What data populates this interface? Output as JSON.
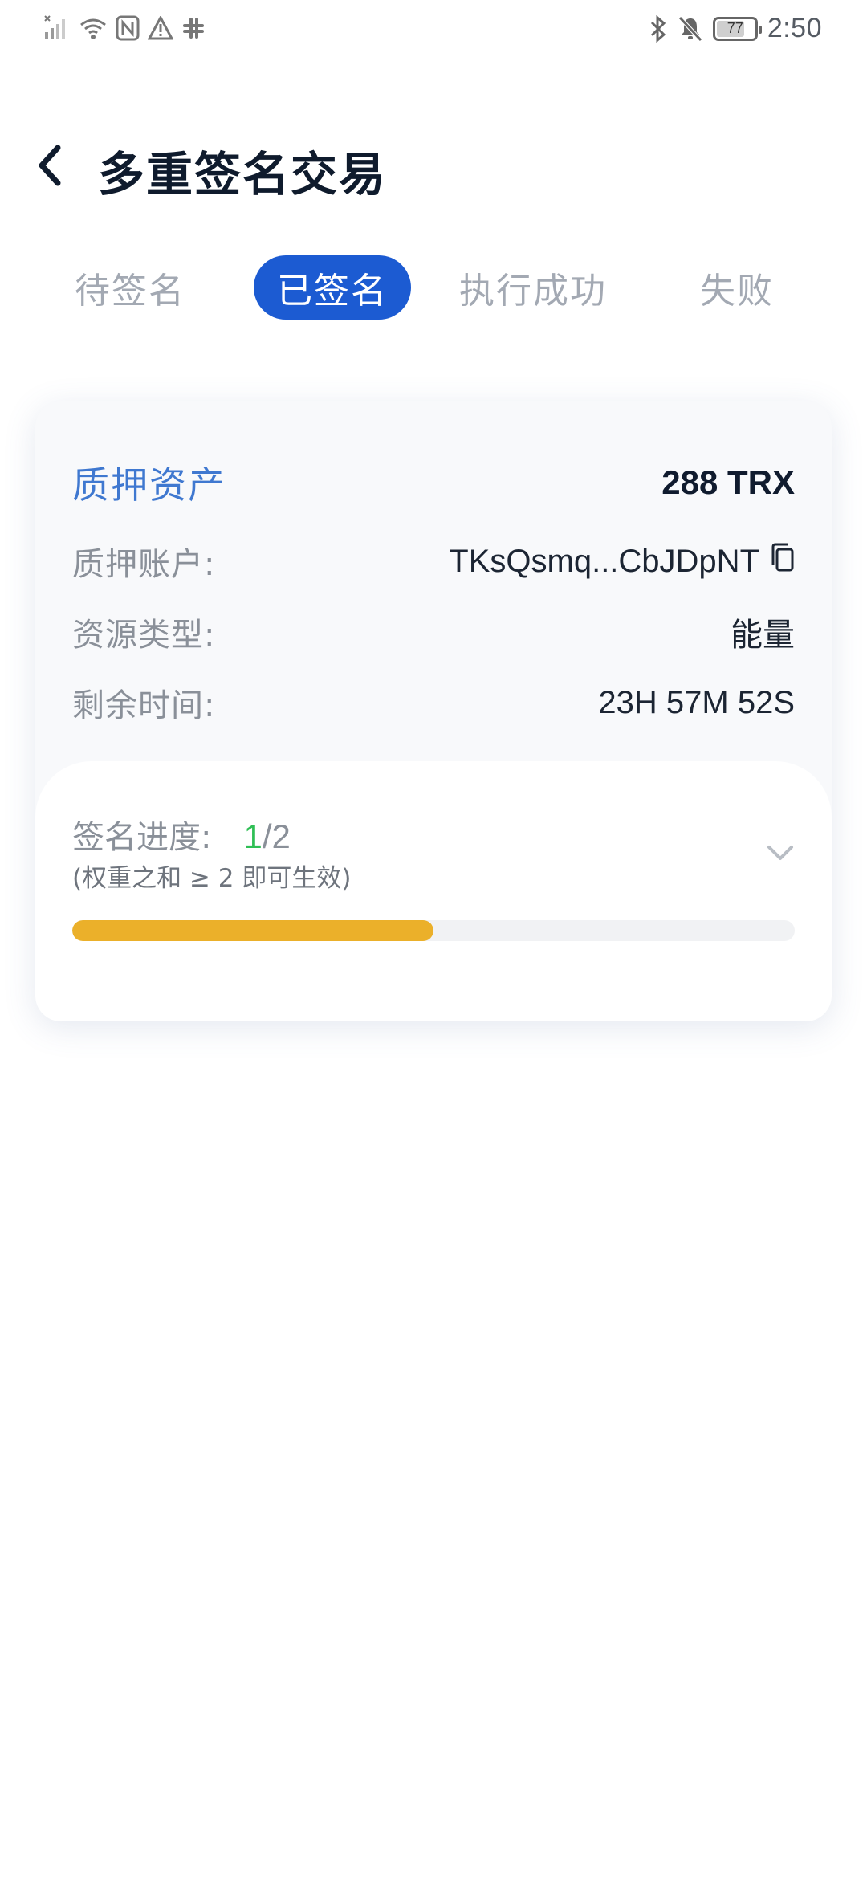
{
  "status_bar": {
    "time": "2:50",
    "battery": "77",
    "battery_level": 0.77,
    "left_icons": [
      "signal-icon",
      "wifi-icon",
      "nfc-icon",
      "warning-icon",
      "slack-icon"
    ],
    "right_icons": [
      "bluetooth-icon",
      "bell-muted-icon",
      "battery-icon"
    ]
  },
  "header": {
    "title": "多重签名交易"
  },
  "tabs": [
    {
      "label": "待签名",
      "active": false
    },
    {
      "label": "已签名",
      "active": true
    },
    {
      "label": "执行成功",
      "active": false
    },
    {
      "label": "失败",
      "active": false
    }
  ],
  "card": {
    "asset_label": "质押资产",
    "asset_value": "288 TRX",
    "fields": [
      {
        "label": "质押账户:",
        "value": "TKsQsmq...CbJDpNT"
      },
      {
        "label": "资源类型:",
        "value": "能量"
      },
      {
        "label": "剩余时间:",
        "value": "23H 57M 52S"
      }
    ],
    "progress": {
      "label": "签名进度:",
      "current": "1",
      "total": "/2",
      "note": "(权重之和 ≥ 2 即可生效)",
      "fraction": 0.5
    }
  },
  "colors": {
    "accent": "#1c5bd2",
    "asset_label": "#3f78d0",
    "progress_fill": "#ebb02a",
    "progress_current": "#2fbf55"
  }
}
